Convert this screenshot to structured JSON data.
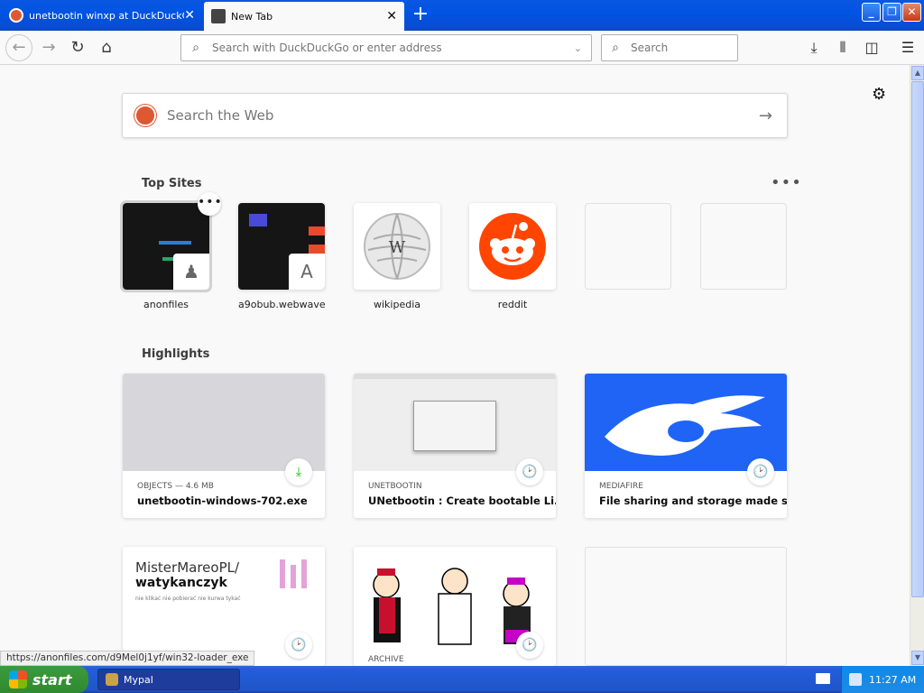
{
  "tabs": [
    {
      "title": "unetbootin winxp at DuckDuckGo",
      "close": "✕"
    },
    {
      "title": "New Tab",
      "close": "✕"
    }
  ],
  "new_tab_symbol": "+",
  "window_controls": {
    "minimize": "_",
    "maximize": "❐",
    "close": "✕"
  },
  "toolbar": {
    "back": "←",
    "forward": "→",
    "reload": "↻",
    "home": "⌂",
    "url_placeholder": "Search with DuckDuckGo or enter address",
    "search_placeholder": "Search",
    "download": "⤓",
    "library": "⫴",
    "sidebar": "◫",
    "menu": "☰"
  },
  "newtab": {
    "settings_icon": "⚙",
    "web_search_placeholder": "Search the Web",
    "web_search_go": "→",
    "top_sites_title": "Top Sites",
    "top_sites_more": "•••",
    "top_sites": [
      {
        "label": "anonfiles",
        "badge": "♟"
      },
      {
        "label": "a9obub.webwave",
        "badge": "A"
      },
      {
        "label": "wikipedia",
        "badge": "W"
      },
      {
        "label": "reddit",
        "badge": ""
      },
      {
        "label": "",
        "badge": ""
      },
      {
        "label": "",
        "badge": ""
      }
    ],
    "site_more": "•••",
    "highlights_title": "Highlights",
    "highlights": [
      {
        "meta": "OBJECTS — 4.6 MB",
        "title": "unetbootin-windows-702.exe",
        "badge": "⤓"
      },
      {
        "meta": "UNETBOOTIN",
        "title": "UNetbootin : Create bootable Li...",
        "badge": "🕑"
      },
      {
        "meta": "MEDIAFIRE",
        "title": "File sharing and storage made si...",
        "badge": "🕑"
      },
      {
        "meta": "",
        "title": "",
        "badge": "🕑",
        "thumb_text": {
          "line1": "MisterMareoPL/",
          "line2": "watykanczyk",
          "line3": "nie klikać nie pobierać nie kurwa tykać"
        }
      },
      {
        "meta": "ARCHIVE",
        "title": "",
        "badge": "🕑"
      }
    ]
  },
  "status_url": "https://anonfiles.com/d9Mel0j1yf/win32-loader_exe",
  "taskbar": {
    "start_label": "start",
    "task_label": "Mypal",
    "clock": "11:27 AM"
  },
  "colors": {
    "xp_blue": "#0054e3",
    "accent": "#de5833",
    "reddit": "#ff4500",
    "mediafire": "#1f64f5"
  }
}
